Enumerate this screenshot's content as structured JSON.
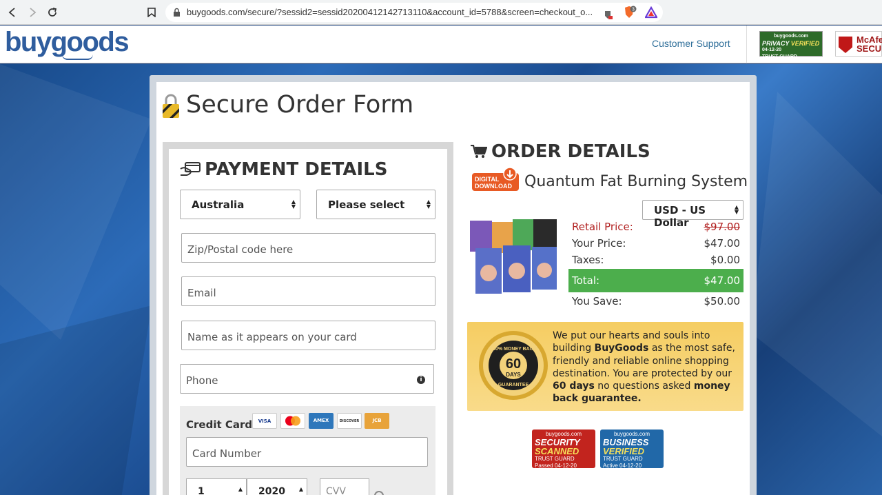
{
  "browser": {
    "url": "buygoods.com/secure/?sessid2=sessid20200412142713110&account_id=5788&screen=checkout_o...",
    "shield_count": "3"
  },
  "header": {
    "logo": "buygoods",
    "support_link": "Customer Support",
    "privacy_badge": {
      "line1": "buygoods.com",
      "line2": "PRIVACY",
      "line3": "VERIFIED",
      "date": "04-12-20",
      "tag": "TRUST GUARD"
    },
    "mcafee_badge": {
      "line1": "McAfee",
      "line2": "SECURE"
    }
  },
  "page": {
    "title": "Secure Order Form"
  },
  "payment": {
    "title": "PAYMENT DETAILS",
    "country": "Australia",
    "state": "Please select",
    "zip_placeholder": "Zip/Postal code here",
    "email_placeholder": "Email",
    "name_placeholder": "Name as it appears on your card",
    "phone_placeholder": "Phone",
    "credit_card_label": "Credit Card",
    "card_logos": [
      "VISA",
      "MC",
      "AMEX",
      "DISCOVER",
      "JCB"
    ],
    "card_number_placeholder": "Card Number",
    "exp_month": "1",
    "exp_year": "2020",
    "cvv_placeholder": "CVV"
  },
  "order": {
    "title": "ORDER DETAILS",
    "badge_line1": "DIGITAL",
    "badge_line2": "DOWNLOAD",
    "product": "Quantum Fat Burning System",
    "currency": "USD - US Dollar",
    "retail_label": "Retail Price:",
    "retail_value": "$97.00",
    "your_label": "Your Price:",
    "your_value": "$47.00",
    "tax_label": "Taxes:",
    "tax_value": "$0.00",
    "total_label": "Total:",
    "total_value": "$47.00",
    "save_label": "You Save:",
    "save_value": "$50.00"
  },
  "guarantee": {
    "seal_top": "100% MONEY BACK",
    "seal_number": "60",
    "seal_days": "DAYS",
    "seal_bottom": "GUARANTEE",
    "t1": "We put our hearts and souls into building ",
    "b1": "BuyGoods",
    "t2": " as the most safe, friendly and reliable online shopping destination. You are protected by our ",
    "b2": "60 days",
    "t3": " no questions asked ",
    "b3": "money back guarantee."
  },
  "trust": {
    "security": {
      "site": "buygoods.com",
      "l1": "SECURITY",
      "l2": "SCANNED",
      "tag": "TRUST GUARD",
      "status": "Passed",
      "date": "04-12-20"
    },
    "business": {
      "site": "buygoods.com",
      "l1": "BUSINESS",
      "l2": "VERIFIED",
      "tag": "TRUST GUARD",
      "status": "Active",
      "date": "04-12-20"
    }
  }
}
